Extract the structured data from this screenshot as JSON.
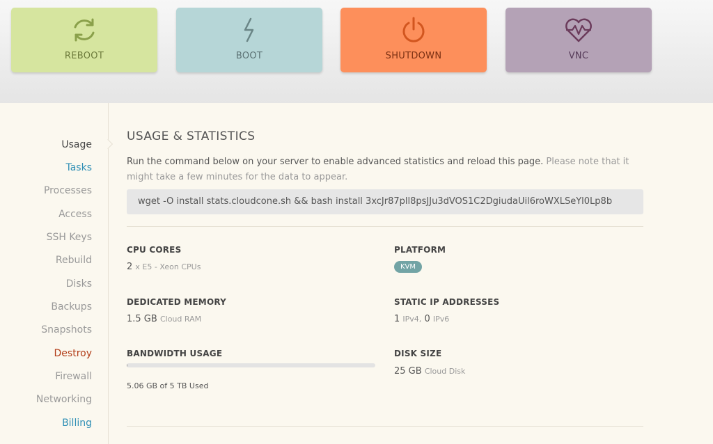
{
  "actions": {
    "reboot": "REBOOT",
    "boot": "BOOT",
    "shutdown": "SHUTDOWN",
    "vnc": "VNC"
  },
  "sidebar": {
    "items": [
      "Usage",
      "Tasks",
      "Processes",
      "Access",
      "SSH Keys",
      "Rebuild",
      "Disks",
      "Backups",
      "Snapshots",
      "Destroy",
      "Firewall",
      "Networking",
      "Billing"
    ]
  },
  "main": {
    "title": "USAGE & STATISTICS",
    "intro": "Run the command below on your server to enable advanced statistics and reload this page.",
    "intro_note": "Please note that it might take a few minutes for the data to appear.",
    "command": "wget -O install stats.cloudcone.sh && bash install 3xcJr87pll8psJJu3dVOS1C2DgiudaUil6roWXLSeYl0Lp8b"
  },
  "stats": {
    "cpu": {
      "label": "CPU CORES",
      "value": "2",
      "unit": "x E5 - Xeon CPUs"
    },
    "platform": {
      "label": "PLATFORM",
      "badge": "KVM"
    },
    "memory": {
      "label": "DEDICATED MEMORY",
      "value": "1.5 GB",
      "unit": "Cloud RAM"
    },
    "ip": {
      "label": "STATIC IP ADDRESSES",
      "v4": "1",
      "v4_unit": "IPv4,",
      "v6": "0",
      "v6_unit": "IPv6"
    },
    "bandwidth": {
      "label": "BANDWIDTH USAGE",
      "used": "5.06 GB of 5 TB Used",
      "percent": 0.1
    },
    "disk": {
      "label": "DISK SIZE",
      "value": "25 GB",
      "unit": "Cloud Disk"
    }
  },
  "colors": {
    "reboot": "#d6e59f",
    "boot": "#b6d6d7",
    "shutdown": "#fd8f5b",
    "vnc": "#b4a2b6",
    "link_blue": "#2f8fb5",
    "danger_red": "#b23c17",
    "badge": "#72a4a5"
  }
}
